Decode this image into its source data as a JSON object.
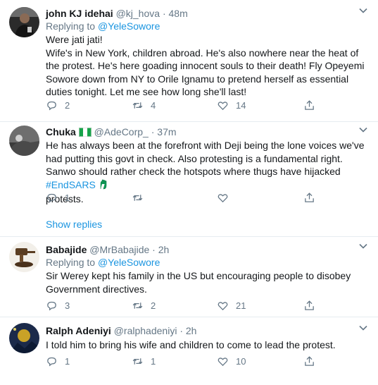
{
  "tweets": [
    {
      "name": "john KJ idehai",
      "handle": "@kj_hova",
      "dot": "·",
      "time": "48m",
      "replying_prefix": "Replying to",
      "replying_to": "@YeleSowore",
      "lines": [
        "Were jati jati!",
        "Wife's in New York, children abroad. He's also nowhere near the heat of the protest. He's here goading innocent souls to their death! Fly Opeyemi Sowore down from NY to Orile Ignamu to pretend herself as essential duties tonight. Let me see how long she'll last!"
      ],
      "replies": "2",
      "retweets": "4",
      "likes": "14"
    },
    {
      "name": "Chuka",
      "handle": "@AdeCorp_",
      "dot": "·",
      "time": "37m",
      "body_text": "He has always been at the forefront with Deji being the lone voices we've had putting this govt in check. Also protesting is a fundamental right. Sanwo should rather check the hotspots where thugs have hijacked ",
      "hashtag": "#EndSARS",
      "body_tail": "protests.",
      "replies": "1",
      "retweets": "",
      "likes": "",
      "show_replies": "Show replies"
    },
    {
      "name": "Babajide",
      "handle": "@MrBabajide",
      "dot": "·",
      "time": "2h",
      "replying_prefix": "Replying to",
      "replying_to": "@YeleSowore",
      "text": "Sir Werey kept his family in the US but encouraging people to disobey Government directives.",
      "replies": "3",
      "retweets": "2",
      "likes": "21"
    },
    {
      "name": "Ralph Adeniyi",
      "handle": "@ralphadeniyi",
      "dot": "·",
      "time": "2h",
      "text": "I told him to bring his wife and children to come to lead the protest.",
      "replies": "1",
      "retweets": "1",
      "likes": "10"
    }
  ],
  "colors": {
    "link": "#1b95e0",
    "muted": "#657786",
    "text": "#14171a",
    "divider": "#e6ecf0"
  }
}
